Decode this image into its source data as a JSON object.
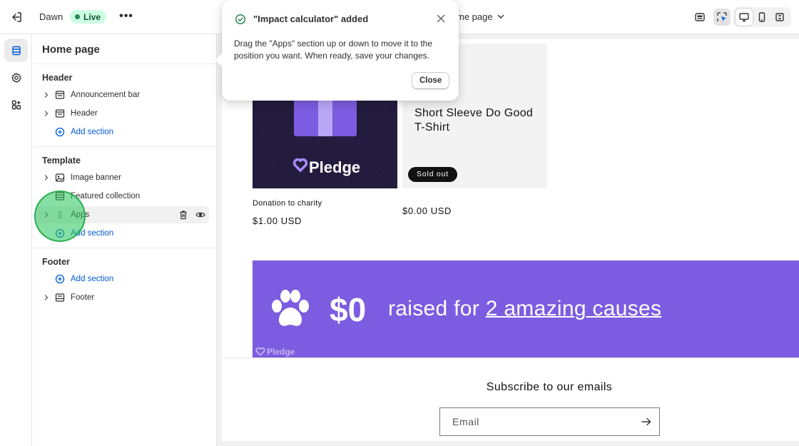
{
  "topbar": {
    "theme_name": "Dawn",
    "live_badge": "Live",
    "more_label": "•••",
    "page_selector": "me page"
  },
  "sidebar": {
    "title": "Home page",
    "groups": {
      "header": {
        "label": "Header",
        "items": [
          "Announcement bar",
          "Header"
        ],
        "add_label": "Add section"
      },
      "template": {
        "label": "Template",
        "items": [
          "Image banner",
          "Featured collection",
          "Apps"
        ],
        "add_label": "Add section"
      },
      "footer": {
        "label": "Footer",
        "add_label": "Add section",
        "items": [
          "Footer"
        ]
      }
    }
  },
  "popover": {
    "title": "\"Impact calculator\" added",
    "body": "Drag the \"Apps\" section up or down to move it to the position you want. When ready, save your changes.",
    "close_button": "Close"
  },
  "preview": {
    "products": [
      {
        "name": "Donation to charity",
        "price": "$1.00 USD",
        "image_brand": "Pledge"
      },
      {
        "name": "Short Sleeve Do Good T-Shirt",
        "price": "$0.00 USD",
        "badge": "Sold out"
      }
    ],
    "impact_banner": {
      "amount": "$0",
      "raised_prefix": "raised for ",
      "causes_link": "2 amazing causes",
      "brand": "Pledge",
      "color": "#7c5ce0"
    },
    "newsletter": {
      "title": "Subscribe to our emails",
      "email_placeholder": "Email"
    }
  },
  "colors": {
    "accent_blue": "#005bd3",
    "live_green": "#29845a",
    "click_indicator": "#27c45a"
  }
}
